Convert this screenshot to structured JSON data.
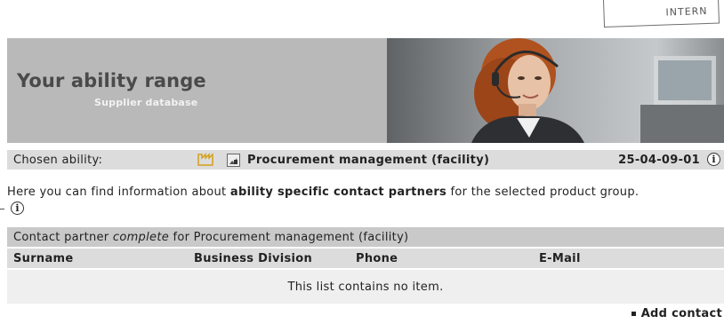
{
  "stamp": "INTERN",
  "banner": {
    "title": "Your ability range",
    "subtitle": "Supplier database"
  },
  "chosen": {
    "label": "Chosen ability:",
    "value": "Procurement management (facility)",
    "code": "25-04-09-01"
  },
  "intro": {
    "text_before": "Here you can find information about ",
    "bold": "ability specific contact partners",
    "text_after": " for the selected product group."
  },
  "contact_table": {
    "group_prefix": "Contact partner ",
    "group_emph": "complete",
    "group_suffix": " for Procurement management (facility)",
    "columns": [
      "Surname",
      "Business Division",
      "Phone",
      "E-Mail"
    ],
    "empty_message": "This list contains no item."
  },
  "add_contact_label": "Add contact",
  "icons": {
    "info": "info-icon",
    "factory": "factory-icon",
    "document": "document-icon"
  },
  "colors": {
    "banner_bg": "#b9b9b9",
    "bar_bg": "#dcdcdc",
    "group_bg": "#c9c9c9",
    "row_bg": "#efefef",
    "accent_icon": "#d4a017"
  }
}
